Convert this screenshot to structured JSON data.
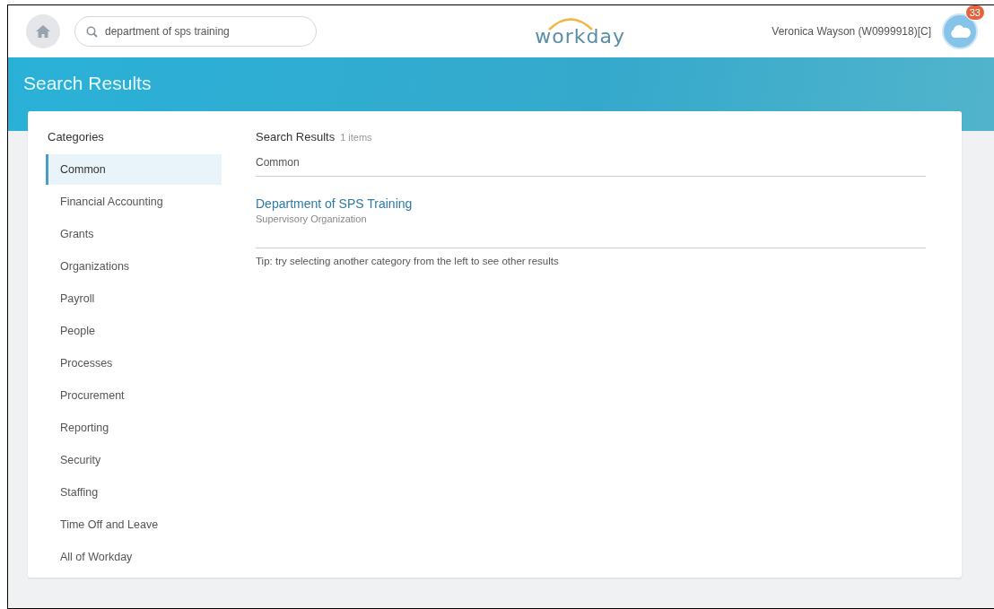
{
  "header": {
    "search": {
      "value": "department of sps training"
    },
    "logo": "workday",
    "user": "Veronica Wayson (W0999918)[C]",
    "notifications": "33"
  },
  "banner": {
    "title": "Search Results"
  },
  "sidebar": {
    "title": "Categories",
    "items": [
      {
        "label": "Common",
        "selected": true
      },
      {
        "label": "Financial Accounting",
        "selected": false
      },
      {
        "label": "Grants",
        "selected": false
      },
      {
        "label": "Organizations",
        "selected": false
      },
      {
        "label": "Payroll",
        "selected": false
      },
      {
        "label": "People",
        "selected": false
      },
      {
        "label": "Processes",
        "selected": false
      },
      {
        "label": "Procurement",
        "selected": false
      },
      {
        "label": "Reporting",
        "selected": false
      },
      {
        "label": "Security",
        "selected": false
      },
      {
        "label": "Staffing",
        "selected": false
      },
      {
        "label": "Time Off and Leave",
        "selected": false
      },
      {
        "label": "All of Workday",
        "selected": false
      }
    ]
  },
  "results": {
    "title": "Search Results",
    "count": "1 items",
    "section": "Common",
    "items": [
      {
        "title": "Department of SPS Training",
        "subtitle": "Supervisory Organization"
      }
    ],
    "tip": "Tip: try selecting another category from the left to see other results"
  }
}
